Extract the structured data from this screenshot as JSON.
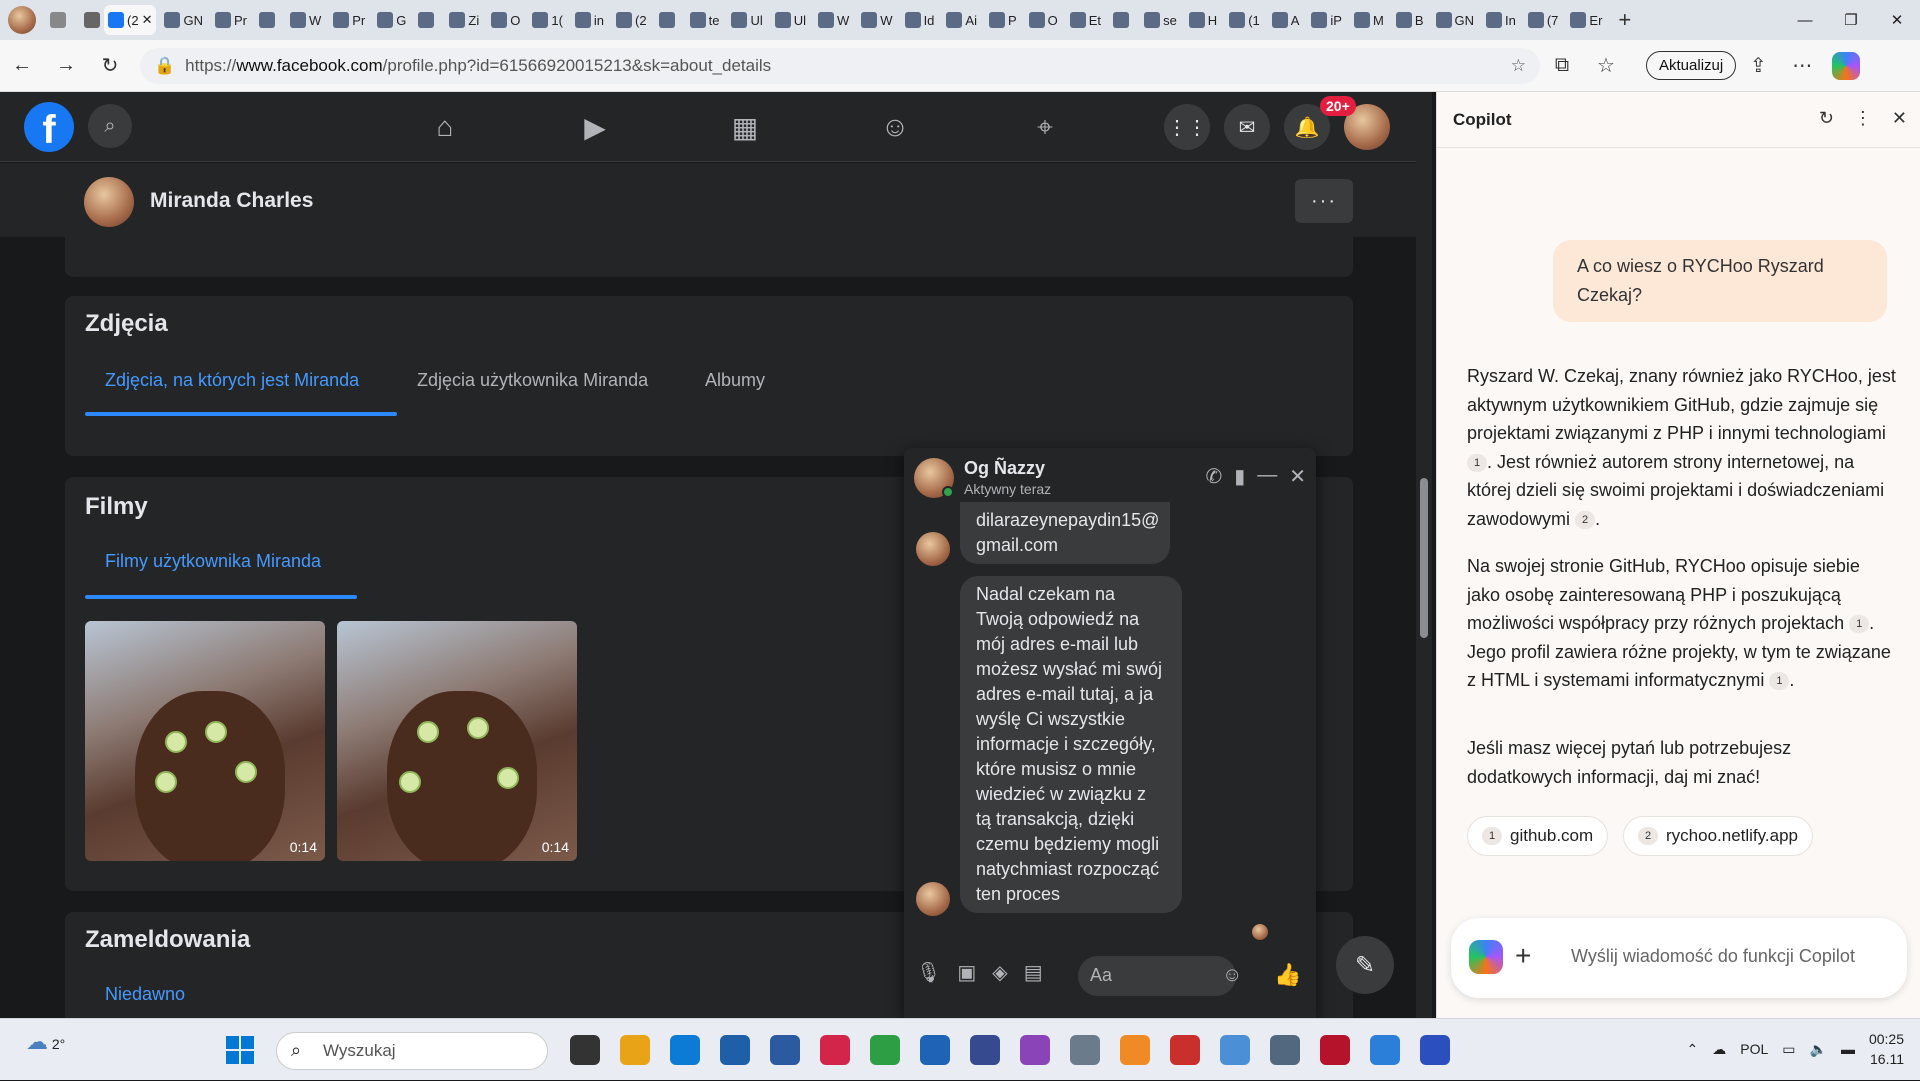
{
  "browser": {
    "active_tab_label": "(2",
    "tab_labels": [
      "GN",
      "Pr",
      "",
      "W",
      "Pr",
      "G",
      "",
      "Zi",
      "O",
      "1(",
      "in",
      "(2",
      "",
      "te",
      "Ul",
      "Ul",
      "W",
      "W",
      "Id",
      "Ai",
      "P",
      "O",
      "Et",
      "",
      "se",
      "H",
      "(1",
      "A",
      "iP",
      "M",
      "B",
      "GN",
      "In",
      "(7",
      "Er"
    ],
    "url_prefix": "https://",
    "url_domain": "www.facebook.com",
    "url_path": "/profile.php?id=61566920015213&sk=about_details",
    "update_label": "Aktualizuj"
  },
  "facebook": {
    "logo": "f",
    "notification_count": "20+",
    "profile_name": "Miranda Charles",
    "more_label": "···",
    "photos": {
      "title": "Zdjęcia",
      "tabs": [
        "Zdjęcia, na których jest Miranda",
        "Zdjęcia użytkownika Miranda",
        "Albumy"
      ]
    },
    "films": {
      "title": "Filmy",
      "tab": "Filmy użytkownika Miranda",
      "videos": [
        {
          "duration": "0:14"
        },
        {
          "duration": "0:14"
        }
      ]
    },
    "checkins": {
      "title": "Zameldowania",
      "tab": "Niedawno"
    }
  },
  "chat": {
    "contact_name": "Og Ñazzy",
    "status": "Aktywny teraz",
    "messages": [
      "dilarazeynepaydin15@ gmail.com",
      "Nadal czekam na Twoją odpowiedź na mój adres e-mail lub możesz wysłać mi swój adres e-mail tutaj, a ja wyślę Ci wszystkie informacje i szczegóły, które musisz o mnie wiedzieć w związku z tą transakcją, dzięki czemu będziemy mogli natychmiast rozpocząć ten proces"
    ],
    "input_placeholder": "Aa"
  },
  "copilot": {
    "title": "Copilot",
    "user_question": "A co wiesz o RYCHoo Ryszard Czekaj?",
    "answer_p1a": "Ryszard W. Czekaj, znany również jako RYCHoo, jest aktywnym użytkownikiem GitHub, gdzie zajmuje się projektami związanymi z PHP i innymi technologiami",
    "answer_p1b": ". Jest również autorem strony internetowej, na której dzieli się swoimi projektami i doświadczeniami zawodowymi",
    "answer_p2a": "Na swojej stronie GitHub, RYCHoo opisuje siebie jako osobę zainteresowaną PHP i poszukującą możliwości współpracy przy różnych projektach",
    "answer_p2b": ". Jego profil zawiera różne projekty, w tym te związane z HTML i systemami informatycznymi",
    "answer_p3": "Jeśli masz więcej pytań lub potrzebujesz dodatkowych informacji, daj mi znać!",
    "cite1": "1",
    "cite2": "2",
    "sources": [
      {
        "num": "1",
        "label": "github.com"
      },
      {
        "num": "2",
        "label": "rychoo.netlify.app"
      }
    ],
    "input_placeholder": "Wyślij wiadomość do funkcji Copilot"
  },
  "taskbar": {
    "temperature": "2°",
    "search_placeholder": "Wyszukaj",
    "language": "POL",
    "time": "00:25",
    "date": "16.11"
  },
  "colors": {
    "fb_blue": "#1877f2",
    "link_blue": "#4599ff",
    "notification_red": "#e41e3f"
  }
}
